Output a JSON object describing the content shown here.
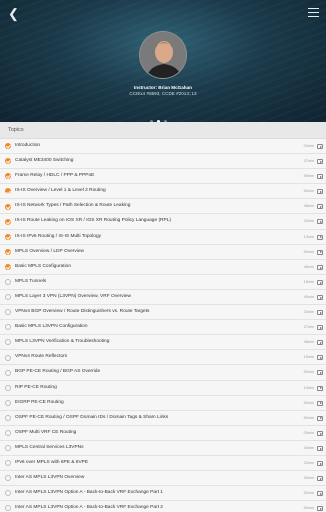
{
  "header": {
    "back_icon": "back-arrow-icon",
    "menu_icon": "hamburger-menu-icon",
    "instructor_name": "Instructor: Brian McGahan",
    "instructor_credentials": "CCIEx4 #8593, CCDE #2013::13",
    "carousel": {
      "total": 3,
      "active": 2
    }
  },
  "section_title": "Topics",
  "topics": [
    {
      "title": "Introduction",
      "duration": "04min",
      "completed": true
    },
    {
      "title": "Catalyst ME3400 Switching",
      "duration": "37min",
      "completed": true
    },
    {
      "title": "Frame Relay / HDLC / PPP & PPPoE",
      "duration": "59min",
      "completed": true
    },
    {
      "title": "IS-IS Overview / Level 1 & Level 2 Routing",
      "duration": "60min",
      "completed": true
    },
    {
      "title": "IS-IS Network Types / Path Selection & Route Leaking",
      "duration": "48min",
      "completed": true
    },
    {
      "title": "IS-IS Route Leaking on IOS XR / IOS XR Routing Policy Language (RPL)",
      "duration": "32min",
      "completed": true
    },
    {
      "title": "IS-IS IPv6 Routing / IS-IS Multi Topology",
      "duration": "13min",
      "completed": true
    },
    {
      "title": "MPLS Overview / LDP Overview",
      "duration": "60min",
      "completed": true
    },
    {
      "title": "Basic MPLS Configuration",
      "duration": "45min",
      "completed": true
    },
    {
      "title": "MPLS Tunnels",
      "duration": "18min",
      "completed": false
    },
    {
      "title": "MPLS Layer 3 VPN (L3VPN) Overview, VRF Overview",
      "duration": "40min",
      "completed": false
    },
    {
      "title": "VPNv4 BGP Overview / Route Distinguishers vs. Route Targets",
      "duration": "23min",
      "completed": false
    },
    {
      "title": "Basic MPLS L3VPN Configuration",
      "duration": "37min",
      "completed": false
    },
    {
      "title": "MPLS L3VPN Verification & Troubleshooting",
      "duration": "48min",
      "completed": false
    },
    {
      "title": "VPNv4 Route Reflectors",
      "duration": "15min",
      "completed": false
    },
    {
      "title": "BGP PE-CE Routing / BGP AS Override",
      "duration": "50min",
      "completed": false
    },
    {
      "title": "RIP PE-CE Routing",
      "duration": "10min",
      "completed": false
    },
    {
      "title": "EIGRP PE-CE Routing",
      "duration": "50min",
      "completed": false
    },
    {
      "title": "OSPF PE-CE Routing / OSPF Domain IDs / Domain Tags & Sham Links",
      "duration": "60min",
      "completed": false
    },
    {
      "title": "OSPF Multi VRF CE Routing",
      "duration": "05min",
      "completed": false
    },
    {
      "title": "MPLS Central Services L3VPNs",
      "duration": "45min",
      "completed": false
    },
    {
      "title": "IPv6 over MPLS with 6PE & 6VPE",
      "duration": "32min",
      "completed": false
    },
    {
      "title": "Inter AS MPLS L3VPN Overview",
      "duration": "30min",
      "completed": false
    },
    {
      "title": "Inter AS MPLS L3VPN Option A - Back-to-Back VRF Exchange Part 1",
      "duration": "52min",
      "completed": false
    },
    {
      "title": "Inter AS MPLS L3VPN Option A - Back-to-Back VRF Exchange Part 2",
      "duration": "60min",
      "completed": false
    }
  ],
  "colors": {
    "accent": "#f08a28",
    "hero": "#1b3a4a"
  }
}
